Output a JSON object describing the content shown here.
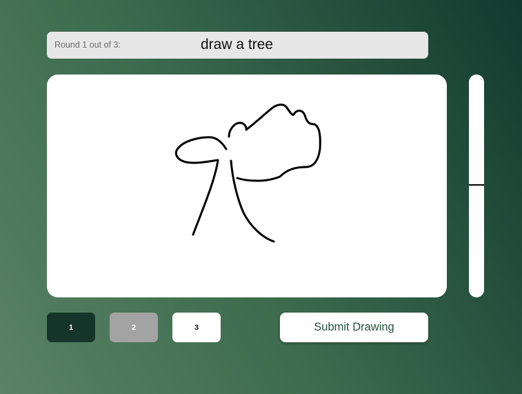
{
  "prompt": {
    "round_label": "Round 1 out of 3:",
    "instruction": "draw a tree"
  },
  "canvas": {
    "stroke_color": "#000000"
  },
  "brush_sizes": [
    {
      "label": "1",
      "state": "selected",
      "color": "#15352b"
    },
    {
      "label": "2",
      "state": "disabled",
      "color": "#a3a3a3"
    },
    {
      "label": "3",
      "state": "default",
      "color": "#ffffff"
    }
  ],
  "submit": {
    "label": "Submit Drawing"
  },
  "colors": {
    "accent_dark": "#15352b",
    "submit_text": "#25533d"
  }
}
